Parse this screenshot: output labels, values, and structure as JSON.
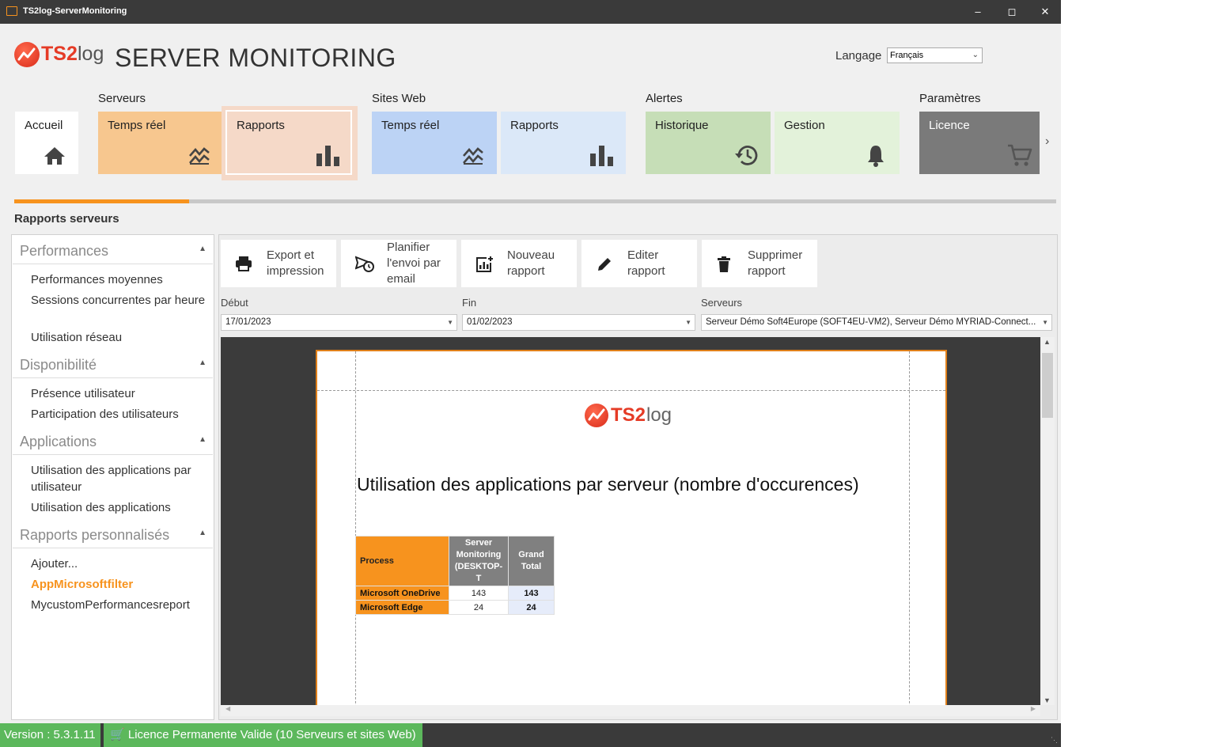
{
  "window": {
    "title": "TS2log-ServerMonitoring"
  },
  "header": {
    "logo_ts": "TS2",
    "logo_log": "log",
    "app_title": "SERVER MONITORING",
    "language_label": "Langage",
    "language_value": "Français"
  },
  "nav": {
    "groups": {
      "servers": "Serveurs",
      "websites": "Sites Web",
      "alerts": "Alertes",
      "settings": "Paramètres"
    },
    "home": "Accueil",
    "srv_realtime": "Temps réel",
    "srv_reports": "Rapports",
    "web_realtime": "Temps réel",
    "web_reports": "Rapports",
    "alert_history": "Historique",
    "alert_management": "Gestion",
    "license": "Licence",
    "colors": {
      "servers": "#f7c78f",
      "servers_selected": "#f5d9c8",
      "web": "#bcd3f5",
      "web_light": "#dbe8f8",
      "alerts": "#c6deb7",
      "alerts_light": "#e3f2da",
      "settings": "#7a7a7a"
    },
    "section_progress": 0.168
  },
  "section_title": "Rapports serveurs",
  "sidebar": {
    "performances": {
      "title": "Performances",
      "items": [
        "Performances moyennes",
        "Sessions concurrentes par heure",
        "Utilisation réseau"
      ]
    },
    "disponibilite": {
      "title": "Disponibilité",
      "items": [
        "Présence utilisateur",
        "Participation des utilisateurs"
      ]
    },
    "applications": {
      "title": "Applications",
      "items": [
        "Utilisation des applications par utilisateur",
        "Utilisation des applications"
      ]
    },
    "custom": {
      "title": "Rapports personnalisés",
      "items": [
        "Ajouter...",
        "AppMicrosoftfilter",
        "MycustomPerformancesreport"
      ]
    }
  },
  "toolbar": {
    "export": "Export et\nimpression",
    "schedule": "Planifier\nl'envoi par\nemail",
    "new": "Nouveau\nrapport",
    "edit": "Editer\nrapport",
    "delete": "Supprimer\nrapport"
  },
  "filters": {
    "start_label": "Début",
    "start_value": "17/01/2023",
    "end_label": "Fin",
    "end_value": "01/02/2023",
    "servers_label": "Serveurs",
    "servers_value": "Serveur Démo Soft4Europe (SOFT4EU-VM2), Serveur Démo MYRIAD-Connect..."
  },
  "report": {
    "logo_ts": "TS2",
    "logo_log": "log",
    "title": "Utilisation des applications par serveur (nombre d'occurences)",
    "headers": {
      "process": "Process",
      "server": "Server Monitoring (DESKTOP-T",
      "grand_total": "Grand Total"
    },
    "rows": [
      {
        "process": "Microsoft OneDrive",
        "value": "143",
        "total": "143"
      },
      {
        "process": "Microsoft Edge",
        "value": "24",
        "total": "24"
      }
    ]
  },
  "status": {
    "version": "Version : 5.3.1.11",
    "license": "Licence Permanente Valide (10 Serveurs et sites Web)"
  }
}
